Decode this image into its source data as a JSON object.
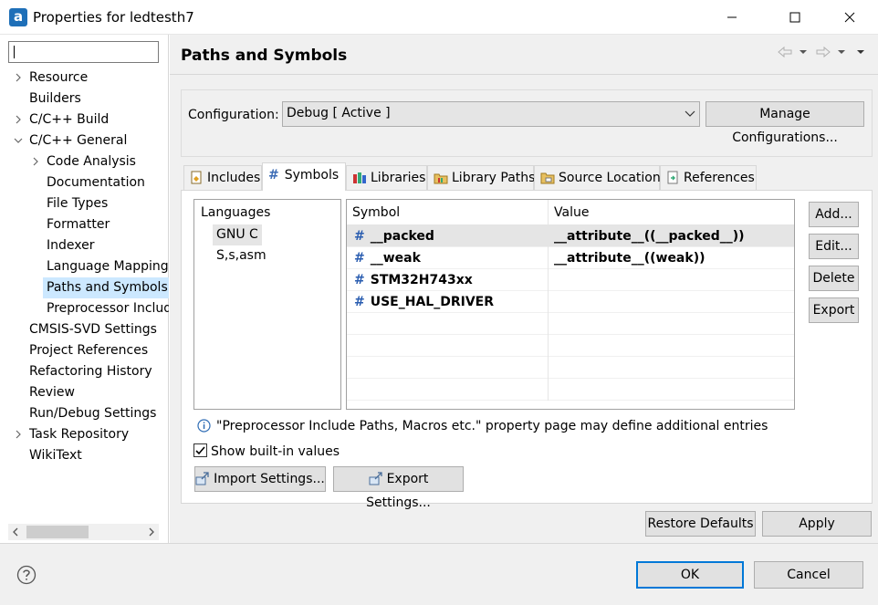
{
  "window": {
    "title": "Properties for ledtesth7",
    "app_icon_letter": "a"
  },
  "nav": {
    "filter_value": "",
    "items": [
      {
        "label": "Resource",
        "expander": "collapsed",
        "level": 0
      },
      {
        "label": "Builders",
        "expander": "none",
        "level": 0
      },
      {
        "label": "C/C++ Build",
        "expander": "collapsed",
        "level": 0
      },
      {
        "label": "C/C++ General",
        "expander": "expanded",
        "level": 0
      },
      {
        "label": "Code Analysis",
        "expander": "collapsed",
        "level": 1
      },
      {
        "label": "Documentation",
        "expander": "none",
        "level": 1
      },
      {
        "label": "File Types",
        "expander": "none",
        "level": 1
      },
      {
        "label": "Formatter",
        "expander": "none",
        "level": 1
      },
      {
        "label": "Indexer",
        "expander": "none",
        "level": 1
      },
      {
        "label": "Language Mappings",
        "expander": "none",
        "level": 1
      },
      {
        "label": "Paths and Symbols",
        "expander": "none",
        "level": 1,
        "selected": true
      },
      {
        "label": "Preprocessor Include Paths",
        "expander": "none",
        "level": 1
      },
      {
        "label": "CMSIS-SVD Settings",
        "expander": "none",
        "level": 0
      },
      {
        "label": "Project References",
        "expander": "none",
        "level": 0
      },
      {
        "label": "Refactoring History",
        "expander": "none",
        "level": 0
      },
      {
        "label": "Review",
        "expander": "none",
        "level": 0
      },
      {
        "label": "Run/Debug Settings",
        "expander": "none",
        "level": 0
      },
      {
        "label": "Task Repository",
        "expander": "collapsed",
        "level": 0
      },
      {
        "label": "WikiText",
        "expander": "none",
        "level": 0
      }
    ]
  },
  "page": {
    "title": "Paths and Symbols",
    "configuration_label": "Configuration:",
    "configuration_value": "Debug  [ Active ]",
    "manage_configurations": "Manage Configurations...",
    "tabs": [
      {
        "label": "Includes",
        "icon": "includes-icon"
      },
      {
        "label": "Symbols",
        "icon": "hash-icon",
        "active": true
      },
      {
        "label": "Libraries",
        "icon": "libraries-icon"
      },
      {
        "label": "Library Paths",
        "icon": "library-paths-icon"
      },
      {
        "label": "Source Location",
        "icon": "source-folder-icon"
      },
      {
        "label": "References",
        "icon": "references-icon"
      }
    ],
    "languages_header": "Languages",
    "languages": [
      {
        "label": "GNU C",
        "selected": true
      },
      {
        "label": "S,s,asm"
      }
    ],
    "table": {
      "columns": [
        "Symbol",
        "Value"
      ],
      "rows": [
        {
          "symbol": "__packed",
          "value": "__attribute__((__packed__))",
          "selected": true
        },
        {
          "symbol": "__weak",
          "value": "__attribute__((weak))"
        },
        {
          "symbol": "STM32H743xx",
          "value": ""
        },
        {
          "symbol": "USE_HAL_DRIVER",
          "value": ""
        }
      ]
    },
    "buttons": {
      "add": "Add...",
      "edit": "Edit...",
      "delete": "Delete",
      "export": "Export"
    },
    "info_text": "\"Preprocessor Include Paths, Macros etc.\" property page may define additional entries",
    "show_builtin_label": "Show built-in values",
    "show_builtin_checked": true,
    "import_settings": "Import Settings...",
    "export_settings": "Export Settings...",
    "restore_defaults": "Restore Defaults",
    "apply": "Apply"
  },
  "footer": {
    "ok": "OK",
    "cancel": "Cancel"
  },
  "colors": {
    "selection": "#cce8ff",
    "accent_blue": "#0078d7",
    "panel_bg": "#f0f0f0"
  }
}
